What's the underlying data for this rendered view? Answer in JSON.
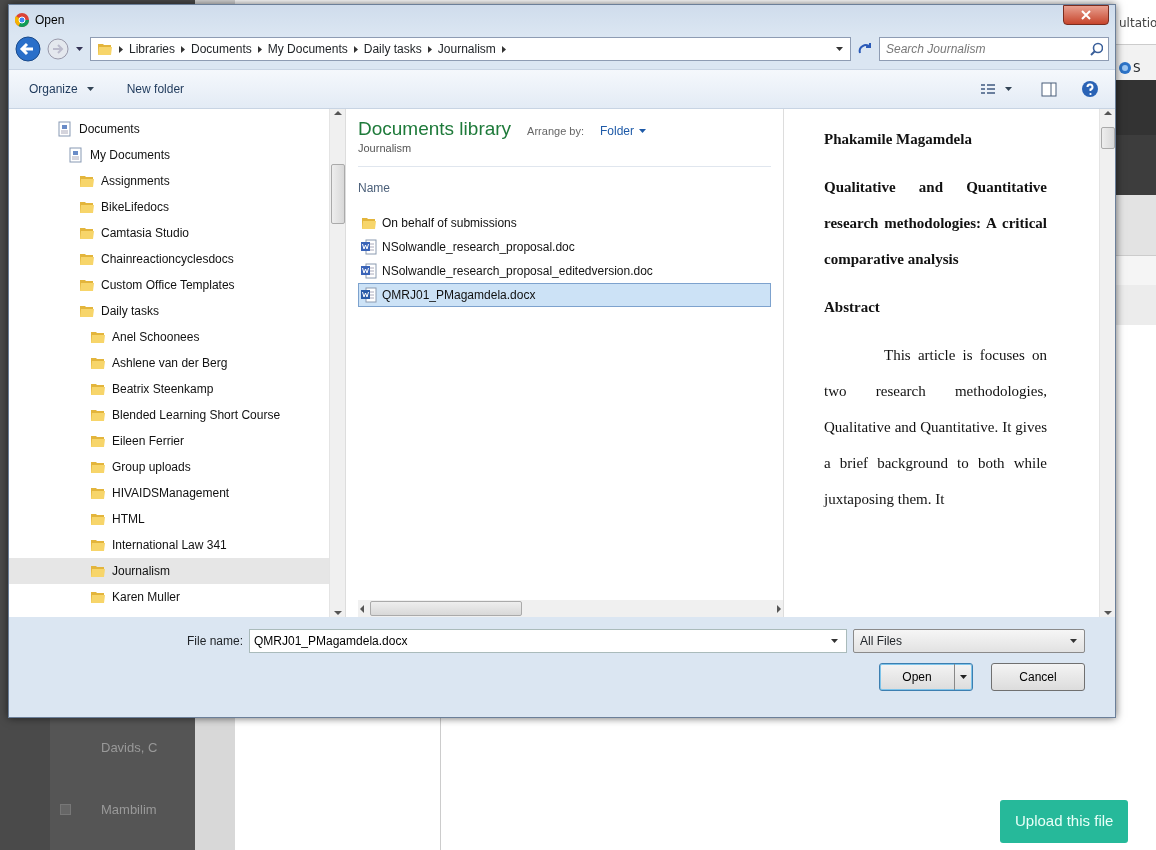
{
  "background_page": {
    "tab_text": "ultatio",
    "link_text": "S",
    "rows": [
      {
        "kind": "plain",
        "name": "Davids, C"
      },
      {
        "kind": "checkbox",
        "name": "Mambilim",
        "checked": false
      }
    ],
    "upload_button": "Upload this file"
  },
  "dialog": {
    "title": "Open",
    "breadcrumb": [
      "Libraries",
      "Documents",
      "My Documents",
      "Daily tasks",
      "Journalism"
    ],
    "search": {
      "placeholder": "Search Journalism"
    },
    "toolbar": [
      {
        "label": "Organize",
        "dropdown": true
      },
      {
        "label": "New folder",
        "dropdown": false
      }
    ],
    "tree": [
      {
        "label": "Documents",
        "kind": "library",
        "selected": false,
        "children": [
          {
            "label": "My Documents",
            "kind": "library",
            "selected": false,
            "children": [
              {
                "label": "Assignments",
                "kind": "folder",
                "selected": false
              },
              {
                "label": "BikeLifedocs",
                "kind": "folder",
                "selected": false
              },
              {
                "label": "Camtasia Studio",
                "kind": "folder",
                "selected": false
              },
              {
                "label": "Chainreactioncyclesdocs",
                "kind": "folder",
                "selected": false
              },
              {
                "label": "Custom Office Templates",
                "kind": "folder",
                "selected": false
              },
              {
                "label": "Daily tasks",
                "kind": "folder",
                "selected": false,
                "children": [
                  {
                    "label": "Anel Schoonees",
                    "kind": "folder",
                    "selected": false
                  },
                  {
                    "label": "Ashlene van der Berg",
                    "kind": "folder",
                    "selected": false
                  },
                  {
                    "label": "Beatrix Steenkamp",
                    "kind": "folder",
                    "selected": false
                  },
                  {
                    "label": "Blended Learning Short Course",
                    "kind": "folder",
                    "selected": false
                  },
                  {
                    "label": "Eileen Ferrier",
                    "kind": "folder",
                    "selected": false
                  },
                  {
                    "label": "Group uploads",
                    "kind": "folder",
                    "selected": false
                  },
                  {
                    "label": "HIVAIDSManagement",
                    "kind": "folder",
                    "selected": false
                  },
                  {
                    "label": "HTML",
                    "kind": "folder",
                    "selected": false
                  },
                  {
                    "label": "International Law 341",
                    "kind": "folder",
                    "selected": false
                  },
                  {
                    "label": "Journalism",
                    "kind": "folder",
                    "selected": true
                  },
                  {
                    "label": "Karen Muller",
                    "kind": "folder",
                    "selected": false
                  }
                ]
              }
            ]
          }
        ]
      }
    ],
    "library": {
      "title": "Documents library",
      "subtitle": "Journalism",
      "arrange_label": "Arrange by:",
      "arrange_value": "Folder",
      "column": "Name",
      "files": [
        {
          "name": "On behalf of submissions",
          "kind": "folder",
          "selected": false
        },
        {
          "name": "NSolwandle_research_proposal.doc",
          "kind": "word",
          "selected": false
        },
        {
          "name": "NSolwandle_research_proposal_editedversion.doc",
          "kind": "word",
          "selected": false
        },
        {
          "name": "QMRJ01_PMagamdela.docx",
          "kind": "wordx",
          "selected": true
        }
      ]
    },
    "preview": [
      {
        "kind": "heading",
        "text": "Phakamile Magamdela"
      },
      {
        "kind": "heading",
        "text": "Qualitative and Quantitative research methodologies: A critical comparative analysis"
      },
      {
        "kind": "heading",
        "text": "Abstract"
      },
      {
        "kind": "body",
        "text": "This article is focuses on two research methodologies, Qualitative and Quantitative. It gives a brief background to both while juxtaposing them. It"
      }
    ],
    "file_name": {
      "label": "File name:",
      "value": "QMRJ01_PMagamdela.docx"
    },
    "filter": "All Files",
    "buttons": [
      {
        "label": "Open",
        "kind": "split",
        "default": true
      },
      {
        "label": "Cancel",
        "kind": "plain",
        "default": false
      }
    ]
  }
}
